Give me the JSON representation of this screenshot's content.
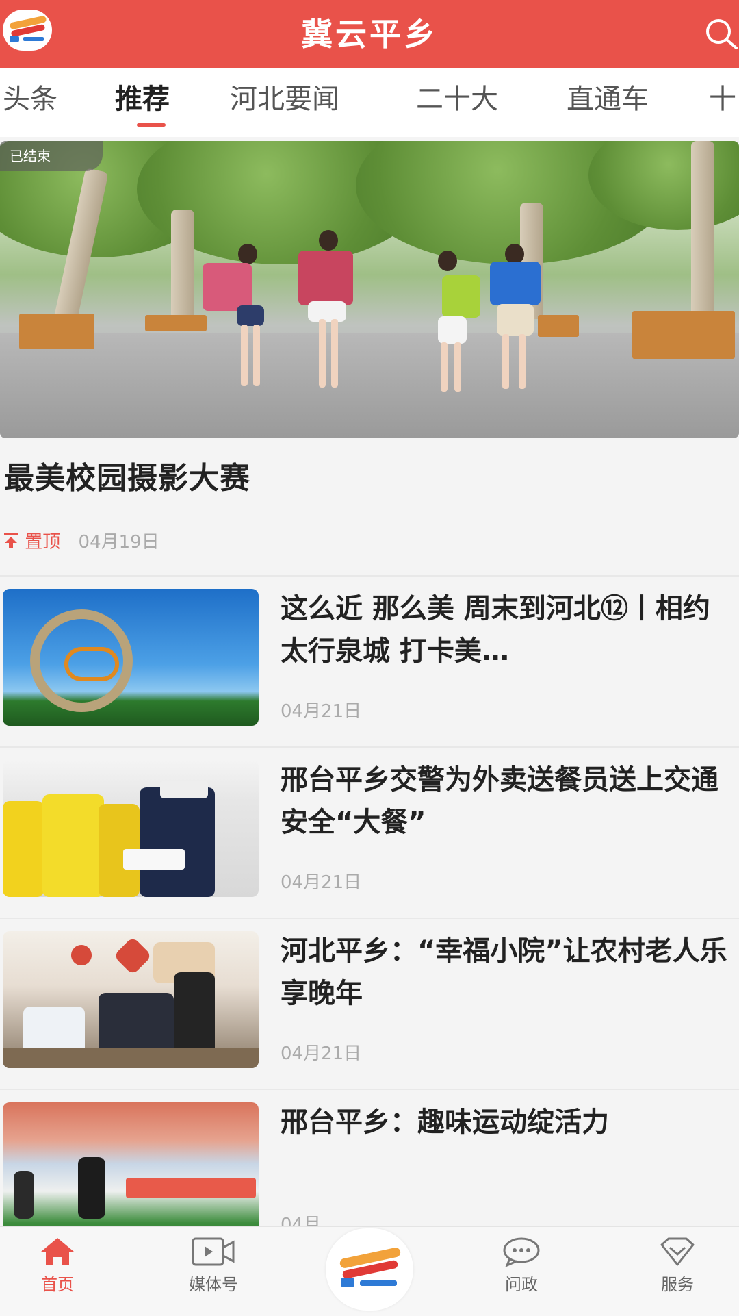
{
  "header": {
    "title": "冀云平乡",
    "logo_icon": "app-logo-icon",
    "search_icon": "search-icon"
  },
  "tabs": [
    {
      "label": "头条",
      "active": false
    },
    {
      "label": "推荐",
      "active": true
    },
    {
      "label": "河北要闻",
      "active": false
    },
    {
      "label": "二十大",
      "active": false
    },
    {
      "label": "直通车",
      "active": false
    },
    {
      "label": "十",
      "active": false
    }
  ],
  "featured": {
    "badge": "已结束",
    "title": "最美校园摄影大赛",
    "pin_label": "置顶",
    "date": "04月19日"
  },
  "news": [
    {
      "title": "这么近 那么美 周末到河北⑫丨相约太行泉城 打卡美…",
      "date": "04月21日"
    },
    {
      "title": "邢台平乡交警为外卖送餐员送上交通安全“大餐”",
      "date": "04月21日"
    },
    {
      "title": "河北平乡：“幸福小院”让农村老人乐享晚年",
      "date": "04月21日"
    },
    {
      "title": "邢台平乡：趣味运动绽活力",
      "date": "04月"
    }
  ],
  "bottom_nav": {
    "items": [
      {
        "label": "首页",
        "icon": "home-icon",
        "active": true
      },
      {
        "label": "媒体号",
        "icon": "video-icon",
        "active": false
      },
      {
        "label": "问政",
        "icon": "chat-icon",
        "active": false
      },
      {
        "label": "服务",
        "icon": "diamond-icon",
        "active": false
      }
    ]
  },
  "colors": {
    "accent": "#e9524a",
    "header_bg": "#e9524a",
    "text": "#222222",
    "muted": "#aaaaaa"
  }
}
